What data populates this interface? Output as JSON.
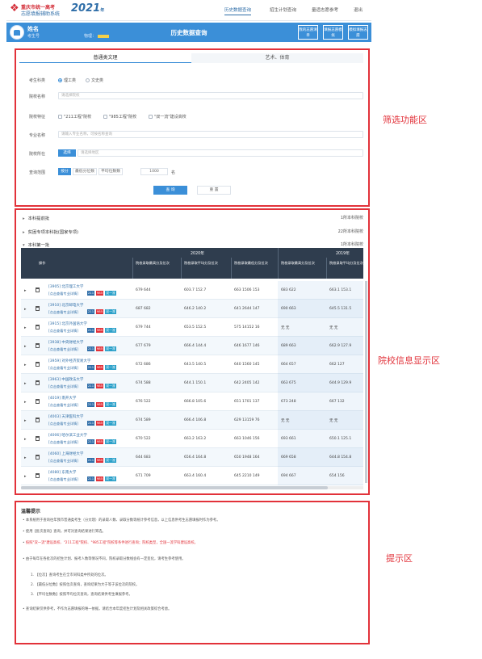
{
  "brand": {
    "line1": "重庆市统一高考",
    "line2": "志愿填报辅助系统",
    "year": "2021",
    "suffix": "年"
  },
  "nav": {
    "items": [
      "历史数据查询",
      "招生计划查询",
      "量适志愿参考",
      "退出"
    ],
    "active_index": 0
  },
  "header": {
    "name": "姓名",
    "id_label": "考生号",
    "score_label": "物理：",
    "title": "历史数据查询",
    "buttons": [
      "我的志愿清单",
      "填报志愿模拟",
      "模拟填报志愿"
    ]
  },
  "filter": {
    "tabs": [
      "普通类文理",
      "艺术、体育"
    ],
    "fields": {
      "subject_type": {
        "label": "考生科类",
        "options": [
          "理工类",
          "文史类"
        ],
        "selected": 0
      },
      "school_name": {
        "label": "院校名称",
        "placeholder": "请选择院校"
      },
      "school_features": {
        "label": "院校特征",
        "options": [
          "\"211工程\"院校",
          "\"985工程\"院校",
          "\"双一流\"建设高校"
        ]
      },
      "major_name": {
        "label": "专业名称",
        "placeholder": "请输入专业名称，可按名称查询"
      },
      "location": {
        "label": "院校所在",
        "button": "选择",
        "placeholder": "请选择地区"
      },
      "score_range": {
        "label": "查询范围",
        "options": [
          "按分",
          "最低分位数",
          "平均位数数"
        ],
        "value": "1000",
        "unit": "名"
      }
    },
    "search_button": "查 询",
    "reset_button": "重 置"
  },
  "results": {
    "sections": [
      {
        "title": "本科提前批",
        "right": "1所本科院校"
      },
      {
        "title": "贫困专项本科批(国家专项)",
        "right": "22所本科院校"
      },
      {
        "title": "本科第一批",
        "right": "1所本科院校"
      }
    ],
    "table_headers": {
      "ops": "操作",
      "years": [
        "2020年",
        "2019年"
      ],
      "subheaders": [
        "院校录取最高分及位次",
        "院校录取平均分及位次",
        "院校录取最低分及位次",
        "院校录取最高分及位次",
        "院校录取平均分及位次"
      ]
    },
    "rows": [
      {
        "school": "[3905] 北京理工大学",
        "link": "[点击查看专业详情]",
        "c": [
          "679 644",
          "603.7 152.7",
          "663 1506 153",
          "683 622",
          "663.1 153.1"
        ]
      },
      {
        "school": "[3910] 北京邮电大学",
        "link": "[点击查看专业详情]",
        "c": [
          "687 682",
          "646.2 140.2",
          "641 2644 147",
          "690 663",
          "645.5 131.5"
        ]
      },
      {
        "school": "[3915] 北京外国语大学",
        "link": "[点击查看专业详情]",
        "c": [
          "679 744",
          "653.5 152.5",
          "575 14152 16",
          "无 无",
          "无 无"
        ]
      },
      {
        "school": "[3938] 中央财经大学",
        "link": "[点击查看专业详情]",
        "c": [
          "677 679",
          "666.4 144.4",
          "646 1677 146",
          "689 663",
          "662.9 127.9"
        ]
      },
      {
        "school": "[3959] 对外经济贸易大学",
        "link": "[点击查看专业详情]",
        "c": [
          "672 686",
          "643.5 140.5",
          "640 1560 145",
          "664 657",
          "662 127"
        ]
      },
      {
        "school": "[3963] 中国政法大学",
        "link": "[点击查看专业详情]",
        "c": [
          "674 588",
          "644.1 150.1",
          "642 2405 142",
          "663 675",
          "644.9 129.9"
        ]
      },
      {
        "school": "[4019] 南开大学",
        "link": "[点击查看专业详情]",
        "c": [
          "676 522",
          "666.8 105.6",
          "651 1701 137",
          "673 248",
          "667 132"
        ]
      },
      {
        "school": "[4003] 天津医科大学",
        "link": "[点击查看专业详情]",
        "c": [
          "674 589",
          "666.4 106.8",
          "629 13159 76",
          "无 无",
          "无 无"
        ]
      },
      {
        "school": "[4006] 哈尔滨工业大学",
        "link": "[点击查看专业详情]",
        "c": [
          "670 522",
          "663.2 163.2",
          "663 1046 156",
          "693 661",
          "650.1 125.1"
        ]
      },
      {
        "school": "[4060] 上海财经大学",
        "link": "[点击查看专业详情]",
        "c": [
          "644 683",
          "656.4 164.8",
          "650 1948 164",
          "669 658",
          "644.8 154.8"
        ]
      },
      {
        "school": "[4080] 东南大学",
        "link": "[点击查看专业详情]",
        "c": [
          "671 709",
          "663.4 160.4",
          "645 2210 149",
          "694 667",
          "654 156"
        ]
      }
    ],
    "tags": [
      "211",
      "985",
      "双一流"
    ]
  },
  "tips": {
    "title": "温馨提示",
    "items": [
      "本系统用于查询往年我市普通类考生（分文理）的录取人数、录取分数等统计参考信息，以上信息供考生志愿填报时作为参考。",
      "使用【批次查询】查询，并可对查询结果进行筛选。",
      "按照\"双一流\"建设高校、\"211工程\"院校、\"985工程\"院校等条件进行查询；院校类型，全国一流学科建设高校。",
      "由于每年在各批次的招生计划、报考人数等情况不同，院校录取分数线会有一定变化，请考生参考使用。",
      "1. 【位次】查询考生在全市同科类中所处的位次。",
      "2. 【最低分位数】按照位次查询，查询结果为大于等于该位次的院校。",
      "3. 【平均位数数】按照平均位次查询，查询结果供考生填报参考。",
      "查询结果仅供参考，不作为志愿填报的唯一依据，请结合本年度招生计划及相关政策综合考虑。"
    ]
  },
  "callouts": [
    "筛选功能区",
    "院校信息显示区",
    "提示区"
  ],
  "colors": {
    "accent": "#3b8fd8",
    "highlight": "#e2323a",
    "table_header": "#2f3d4e"
  }
}
